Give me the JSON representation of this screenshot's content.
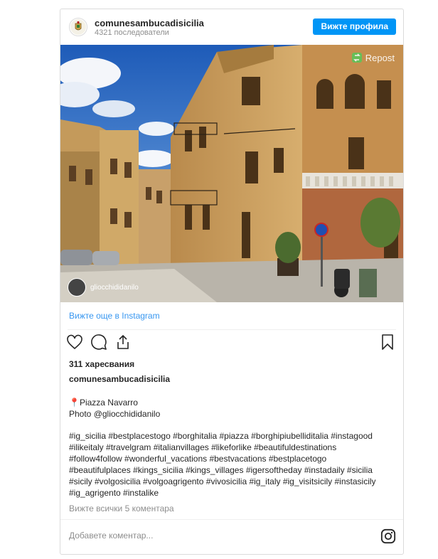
{
  "header": {
    "username": "comunesambucadisicilia",
    "followers": "4321 последователи",
    "view_profile_label": "Вижте профила"
  },
  "photo": {
    "repost_label": "Repost",
    "credit_handle": "gliocchididanilo"
  },
  "more_link": "Вижте още в Instagram",
  "likes": "311 харесвания",
  "caption": {
    "username": "comunesambucadisicilia",
    "location": "📍Piazza Navarro",
    "photo_credit": "Photo @gliocchididanilo",
    "hashtags": [
      "#ig_sicilia #bestplacestogo #borghitalia #piazza #borghipiubelliditalia #instagood",
      "#ilikeitaly #travelgram #italianvillages #likeforlike #beautifuldestinations",
      "#follow4follow #wonderful_vacations #bestvacations #bestplacetogo",
      "#beautifulplaces #kings_sicilia #kings_villages #igersoftheday #instadaily #sicilia",
      "#sicily #volgosicilia #volgoagrigento #vivosicilia #ig_italy #ig_visitsicily #instasicily",
      "#ig_agrigento #instalike"
    ]
  },
  "view_comments": "Вижте всички 5 коментара",
  "comment_placeholder": "Добавете коментар...",
  "colors": {
    "accent": "#0095f6",
    "link": "#3897f0",
    "muted": "#8e8e8e",
    "border": "#dbdbdb"
  },
  "icons": [
    "heart-icon",
    "comment-icon",
    "share-icon",
    "bookmark-icon",
    "instagram-icon",
    "repost-icon"
  ]
}
